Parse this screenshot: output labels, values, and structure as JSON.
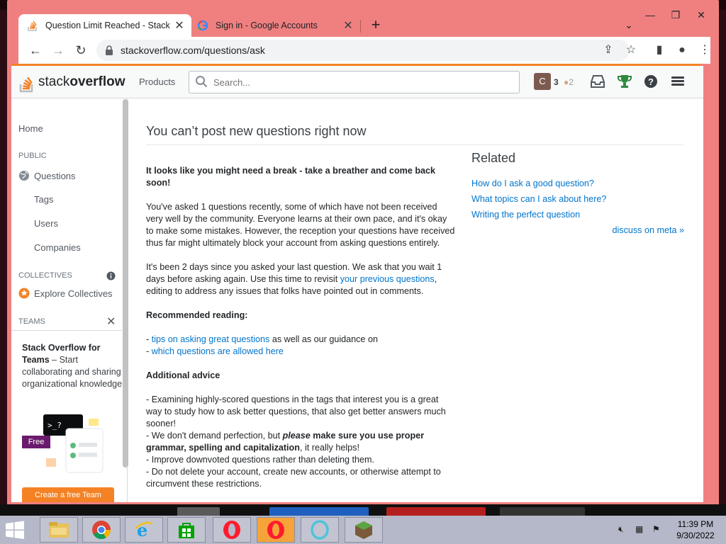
{
  "browser": {
    "tabs": [
      {
        "title": "Question Limit Reached - Stack O",
        "active": true
      },
      {
        "title": "Sign in - Google Accounts",
        "active": false
      }
    ],
    "address": "stackoverflow.com/questions/ask"
  },
  "so_header": {
    "logo_light": "stack",
    "logo_bold": "overflow",
    "products": "Products",
    "search_placeholder": "Search...",
    "avatar_initial": "C",
    "reputation": "3",
    "bronze_badges": "2"
  },
  "sidebar": {
    "home": "Home",
    "public_label": "PUBLIC",
    "questions": "Questions",
    "tags": "Tags",
    "users": "Users",
    "companies": "Companies",
    "collectives_label": "COLLECTIVES",
    "explore_collectives": "Explore Collectives",
    "teams_label": "TEAMS",
    "teams_title": "Stack Overflow for Teams",
    "teams_desc": " – Start collaborating and sharing organizational knowledge.",
    "free_tag": "Free",
    "create_team": "Create a free Team"
  },
  "main": {
    "title": "You can’t post new questions right now",
    "lead": "It looks like you might need a break - take a breather and come back soon!",
    "para1": "You've asked 1 questions recently, some of which have not been received very well by the community. Everyone learns at their own pace, and it's okay to make some mistakes. However, the reception your questions have received thus far might ultimately block your account from asking questions entirely.",
    "para2_a": "It's been 2 days since you asked your last question. We ask that you wait 1 days before asking again. Use this time to revisit ",
    "para2_link": "your previous questions",
    "para2_b": ", editing to address any issues that folks have pointed out in comments.",
    "rec_heading": "Recommended reading:",
    "rec1_prefix": "- ",
    "rec1_link": "tips on asking great questions",
    "rec1_suffix": " as well as our guidance on",
    "rec2_prefix": "- ",
    "rec2_link": "which questions are allowed here",
    "adv_heading": "Additional advice",
    "adv1": "- Examining highly-scored questions in the tags that interest you is a great way to study how to ask better questions, that also get better answers much sooner!",
    "adv2_a": "- We don't demand perfection, but ",
    "adv2_em": "please",
    "adv2_b": " make sure you use proper grammar, spelling and capitalization",
    "adv2_c": ", it really helps!",
    "adv3": "- Improve downvoted questions rather than deleting them.",
    "adv4": "- Do not delete your account, create new accounts, or otherwise attempt to circumvent these restrictions."
  },
  "related": {
    "heading": "Related",
    "links": [
      "How do I ask a good question?",
      "What topics can I ask about here?",
      "Writing the perfect question"
    ],
    "meta": "discuss on meta »"
  },
  "taskbar": {
    "time": "11:39 PM",
    "date": "9/30/2022"
  },
  "colors": {
    "so_orange": "#f48225",
    "link_blue": "#0074cc",
    "window_frame": "#f08080"
  }
}
